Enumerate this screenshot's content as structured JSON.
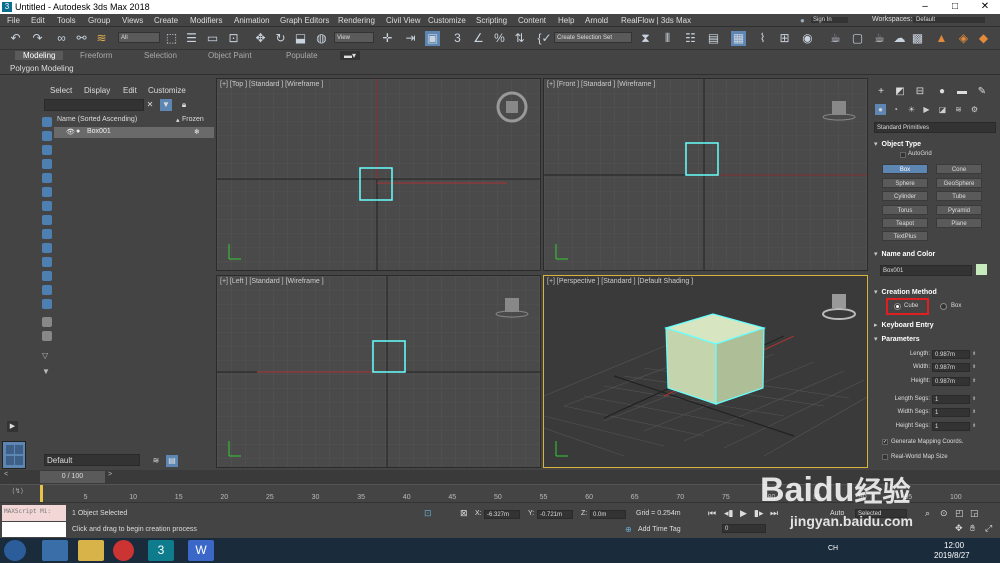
{
  "window": {
    "title": "Untitled - Autodesk 3ds Max 2018"
  },
  "menu": {
    "items": [
      "File",
      "Edit",
      "Tools",
      "Group",
      "Views",
      "Create",
      "Modifiers",
      "Animation",
      "Graph Editors",
      "Rendering",
      "Civil View",
      "Customize",
      "Scripting",
      "Content",
      "Help",
      "Arnold",
      "RealFlow | 3ds Max"
    ],
    "signin": "Sign In",
    "workspaces_label": "Workspaces:",
    "workspaces_value": "Default"
  },
  "toolbar": {
    "filter_value": "All",
    "refcoord_value": "View",
    "selection_set": "Create Selection Set"
  },
  "ribbon": {
    "tabs": [
      "Modeling",
      "Freeform",
      "Selection",
      "Object Paint",
      "Populate"
    ],
    "subtitle": "Polygon Modeling"
  },
  "scene_explorer": {
    "menu": [
      "Select",
      "Display",
      "Edit",
      "Customize"
    ],
    "column_name": "Name (Sorted Ascending)",
    "column_frozen": "Frozen",
    "object": "Box001",
    "layer": "Default"
  },
  "viewports": {
    "top": "[+] [Top ] [Standard ] [Wireframe ]",
    "front": "[+] [Front ] [Standard ] [Wireframe ]",
    "left": "[+] [Left ] [Standard ] [Wireframe ]",
    "perspective": "[+] [Perspective ] [Standard ] [Default Shading ]"
  },
  "command_panel": {
    "category": "Standard Primitives",
    "object_type": {
      "title": "Object Type",
      "autogrid": "AutoGrid",
      "buttons": [
        "Box",
        "Cone",
        "Sphere",
        "GeoSphere",
        "Cylinder",
        "Tube",
        "Torus",
        "Pyramid",
        "Teapot",
        "Plane",
        "TextPlus"
      ]
    },
    "name_color": {
      "title": "Name and Color",
      "name": "Box001",
      "color": "#c8ebbe"
    },
    "creation_method": {
      "title": "Creation Method",
      "cube": "Cube",
      "box": "Box",
      "highlight": "#e02020"
    },
    "keyboard_entry": "Keyboard Entry",
    "parameters": {
      "title": "Parameters",
      "length_label": "Length:",
      "length": "0.987m",
      "width_label": "Width:",
      "width": "0.987m",
      "height_label": "Height:",
      "height": "0.987m",
      "lsegs_label": "Length Segs:",
      "lsegs": "1",
      "wsegs_label": "Width Segs:",
      "wsegs": "1",
      "hsegs_label": "Height Segs:",
      "hsegs": "1",
      "gen_mapping": "Generate Mapping Coords.",
      "realworld": "Real-World Map Size"
    }
  },
  "timeline": {
    "frame": "0 / 100",
    "ticks": [
      "5",
      "10",
      "15",
      "20",
      "25",
      "30",
      "35",
      "40",
      "45",
      "50",
      "55",
      "60",
      "65",
      "70",
      "75",
      "80",
      "85",
      "90",
      "95",
      "100"
    ]
  },
  "status": {
    "maxscript": "MAXScript Mi:",
    "selected": "1 Object Selected",
    "prompt": "Click and drag to begin creation process",
    "x_label": "X:",
    "x": "-6.327m",
    "y_label": "Y:",
    "y": "-0.721m",
    "z_label": "Z:",
    "z": "0.0m",
    "grid": "Grid = 0.254m",
    "add_time_tag": "Add Time Tag",
    "auto": "Auto",
    "selected_dd": "Selected",
    "frame_field": "0"
  },
  "taskbar": {
    "ime": "CH",
    "time": "12:00",
    "date": "2019/8/27"
  },
  "watermark": {
    "brand": "Baidu",
    "cn": "经验",
    "url": "jingyan.baidu.com"
  }
}
